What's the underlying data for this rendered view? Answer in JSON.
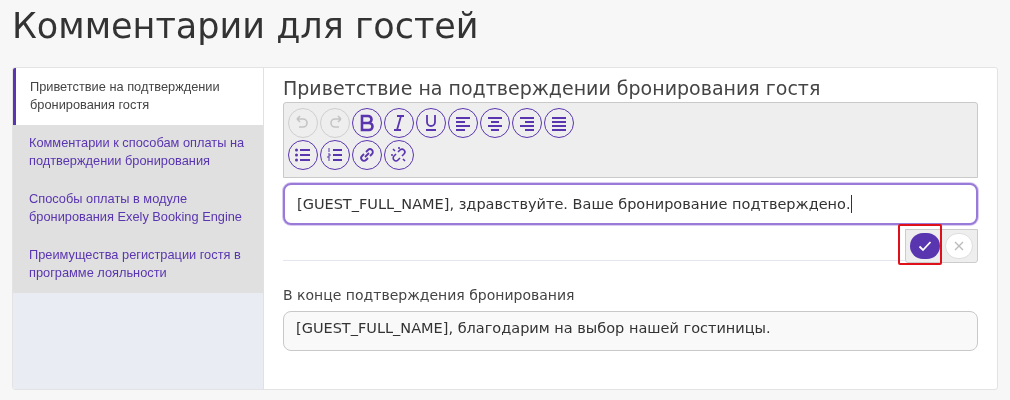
{
  "page": {
    "title": "Комментарии для гостей"
  },
  "sidebar": {
    "items": [
      {
        "label": "Приветствие на подтверждении бронирования гостя",
        "selected": true
      },
      {
        "label": "Комментарии к способам оплаты на подтверждении бронирования",
        "selected": false
      },
      {
        "label": "Способы оплаты в модуле бронирования Exely Booking Engine",
        "selected": false
      },
      {
        "label": "Преимущества регистрации гостя в программе лояльности",
        "selected": false
      }
    ]
  },
  "section": {
    "heading": "Приветствие на подтверждении бронирования гостя"
  },
  "toolbar": {
    "rows": [
      [
        {
          "kind": "undo",
          "disabled": true
        },
        {
          "kind": "redo",
          "disabled": true
        },
        {
          "kind": "bold",
          "disabled": false
        },
        {
          "kind": "italic",
          "disabled": false
        },
        {
          "kind": "underline",
          "disabled": false
        },
        {
          "kind": "align-left",
          "disabled": false
        },
        {
          "kind": "align-center",
          "disabled": false
        },
        {
          "kind": "align-right",
          "disabled": false
        },
        {
          "kind": "justify",
          "disabled": false
        }
      ],
      [
        {
          "kind": "bullets",
          "disabled": false
        },
        {
          "kind": "numbers",
          "disabled": false
        },
        {
          "kind": "link",
          "disabled": false
        },
        {
          "kind": "unlink",
          "disabled": false
        }
      ]
    ]
  },
  "editor": {
    "value": "[GUEST_FULL_NAME], здравствуйте. Ваше бронирование подтверждено.",
    "focused": true
  },
  "actions": {
    "highlighted": true
  },
  "closing": {
    "label": "В конце подтверждения бронирования",
    "value": "[GUEST_FULL_NAME], благодарим на выбор нашей гостиницы."
  }
}
